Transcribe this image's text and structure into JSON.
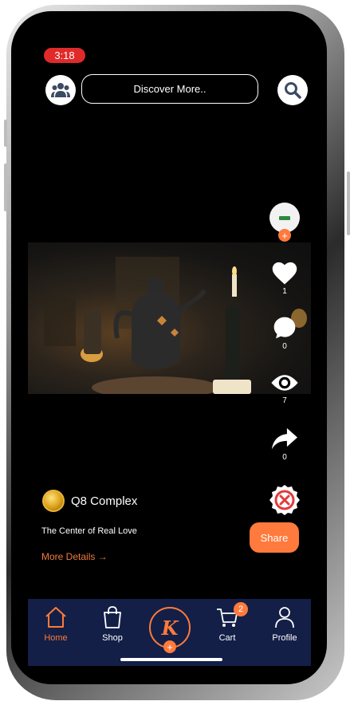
{
  "status_bar": {
    "time": "3:18"
  },
  "header": {
    "search_label": "Discover More.."
  },
  "rail": {
    "likes": "1",
    "comments": "0",
    "views": "7",
    "shares": "0"
  },
  "post": {
    "channel_name": "Q8 Complex",
    "tagline": "The Center of Real Love",
    "more_details": "More Details →",
    "share_label": "Share"
  },
  "bottom_nav": {
    "home": "Home",
    "shop": "Shop",
    "center_letter": "K",
    "cart": "Cart",
    "cart_badge": "2",
    "profile": "Profile"
  },
  "colors": {
    "accent": "#ff7a3c",
    "nav_bg": "#131f47",
    "time_pill": "#e02a2a"
  }
}
